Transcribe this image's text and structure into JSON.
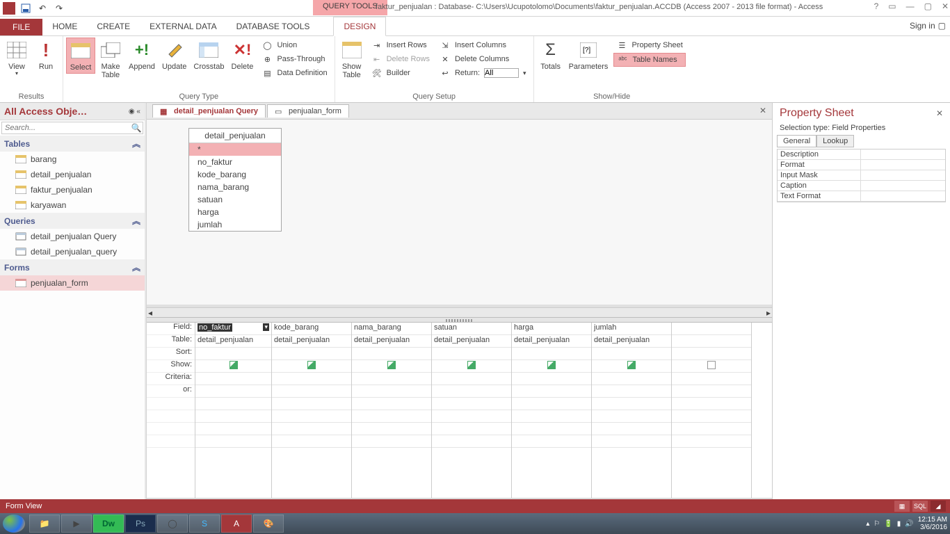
{
  "titlebar": {
    "query_tools": "QUERY TOOLS",
    "title": "faktur_penjualan : Database- C:\\Users\\Ucupotolomo\\Documents\\faktur_penjualan.ACCDB (Access 2007 - 2013 file format) - Access"
  },
  "ribbon_tabs": {
    "file": "FILE",
    "home": "HOME",
    "create": "CREATE",
    "external": "EXTERNAL DATA",
    "dbtools": "DATABASE TOOLS",
    "design": "DESIGN",
    "signin": "Sign in"
  },
  "ribbon": {
    "results": {
      "view": "View",
      "run": "Run",
      "label": "Results"
    },
    "qtype": {
      "select": "Select",
      "maketable": "Make\nTable",
      "append": "Append",
      "update": "Update",
      "crosstab": "Crosstab",
      "delete": "Delete",
      "union": "Union",
      "passthrough": "Pass-Through",
      "datadef": "Data Definition",
      "label": "Query Type"
    },
    "qsetup": {
      "showtable": "Show\nTable",
      "insertrows": "Insert Rows",
      "deleterows": "Delete Rows",
      "builder": "Builder",
      "insertcols": "Insert Columns",
      "deletecols": "Delete Columns",
      "return": "Return:",
      "returnval": "All",
      "label": "Query Setup"
    },
    "showhide": {
      "totals": "Totals",
      "parameters": "Parameters",
      "propsheet": "Property Sheet",
      "tablenames": "Table Names",
      "label": "Show/Hide"
    }
  },
  "nav": {
    "title": "All Access Obje…",
    "search_ph": "Search...",
    "tables_label": "Tables",
    "queries_label": "Queries",
    "forms_label": "Forms",
    "tables": [
      "barang",
      "detail_penjualan",
      "faktur_penjualan",
      "karyawan"
    ],
    "queries": [
      "detail_penjualan Query",
      "detail_penjualan_query"
    ],
    "forms": [
      "penjualan_form"
    ]
  },
  "doc_tabs": {
    "tab1": "detail_penjualan Query",
    "tab2": "penjualan_form"
  },
  "table_box": {
    "title": "detail_penjualan",
    "fields": [
      "*",
      "no_faktur",
      "kode_barang",
      "nama_barang",
      "satuan",
      "harga",
      "jumlah"
    ]
  },
  "grid": {
    "labels": {
      "field": "Field:",
      "table": "Table:",
      "sort": "Sort:",
      "show": "Show:",
      "criteria": "Criteria:",
      "or": "or:"
    },
    "cols": [
      {
        "field": "no_faktur",
        "table": "detail_penjualan",
        "show": true,
        "selected": true
      },
      {
        "field": "kode_barang",
        "table": "detail_penjualan",
        "show": true
      },
      {
        "field": "nama_barang",
        "table": "detail_penjualan",
        "show": true
      },
      {
        "field": "satuan",
        "table": "detail_penjualan",
        "show": true
      },
      {
        "field": "harga",
        "table": "detail_penjualan",
        "show": true
      },
      {
        "field": "jumlah",
        "table": "detail_penjualan",
        "show": true
      },
      {
        "field": "",
        "table": "",
        "show": false
      }
    ]
  },
  "prop": {
    "title": "Property Sheet",
    "subtitle": "Selection type:  Field Properties",
    "tabs": {
      "general": "General",
      "lookup": "Lookup"
    },
    "rows": [
      "Description",
      "Format",
      "Input Mask",
      "Caption",
      "Text Format"
    ]
  },
  "statusbar": {
    "text": "Form View",
    "sql": "SQL"
  },
  "taskbar": {
    "time": "12:15 AM",
    "date": "3/6/2016"
  }
}
